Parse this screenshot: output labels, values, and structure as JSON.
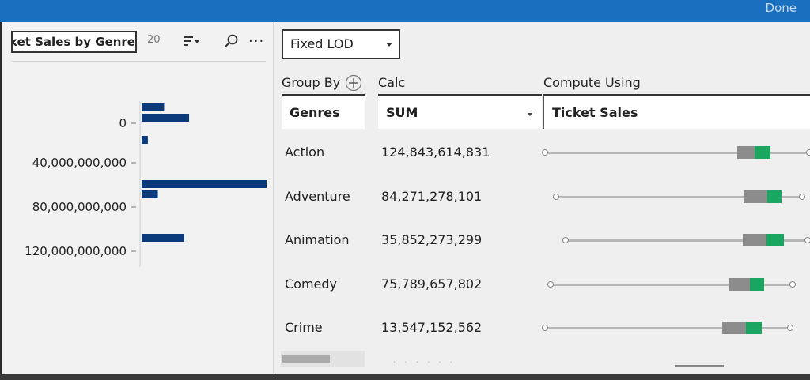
{
  "header": {
    "done_label": "Done",
    "accent": "#1b6fbf"
  },
  "left_panel": {
    "title_value": "Ticket Sales by Genre",
    "count": "20",
    "icons": [
      "sort-icon",
      "search-icon",
      "more-icon"
    ],
    "more_label": "···"
  },
  "chart_data": {
    "type": "bar",
    "orientation": "horizontal",
    "bar_color": "#0b3a7a",
    "tick_labels": [
      "0",
      "40,000,000,000",
      "80,000,000,000",
      "120,000,000,000"
    ],
    "bars": [
      {
        "tick": "0",
        "value": 0.18
      },
      {
        "tick": "0",
        "value": 0.38
      },
      {
        "tick": "40,000,000,000",
        "value": 0.05
      },
      {
        "tick": "80,000,000,000",
        "value": 1.0
      },
      {
        "tick": "80,000,000,000",
        "value": 0.13
      },
      {
        "tick": "120,000,000,000",
        "value": 0.34
      }
    ]
  },
  "right_panel": {
    "dropdown_value": "Fixed LOD",
    "group_by_label": "Group By",
    "calc_label": "Calc",
    "compute_label": "Compute Using",
    "col_genres": "Genres",
    "col_calc": "SUM",
    "col_compute": "Ticket Sales",
    "rows": [
      {
        "genre": "Action",
        "value": "124,843,614,831"
      },
      {
        "genre": "Adventure",
        "value": "84,271,278,101"
      },
      {
        "genre": "Animation",
        "value": "35,852,273,299"
      },
      {
        "genre": "Comedy",
        "value": "75,789,657,802"
      },
      {
        "genre": "Crime",
        "value": "13,547,152,562"
      }
    ],
    "colors": {
      "gray": "#8c8c8c",
      "green": "#1aa561"
    }
  }
}
